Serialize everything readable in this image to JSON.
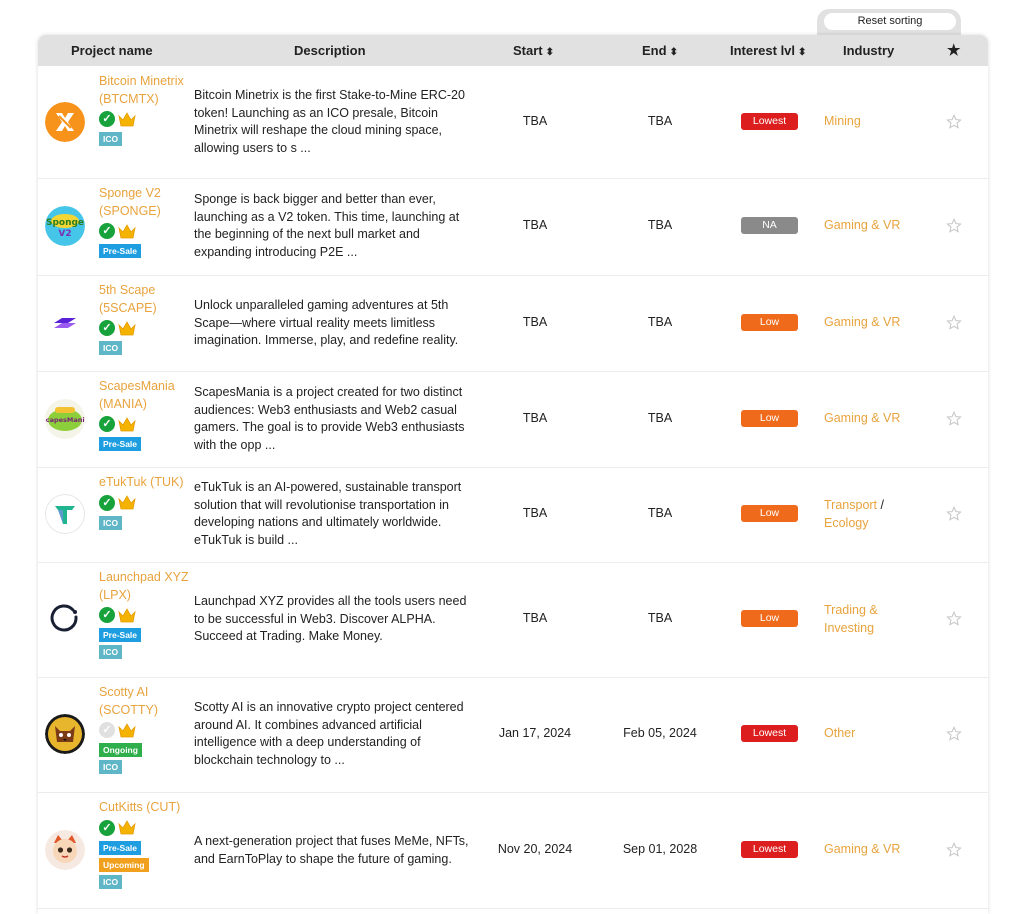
{
  "reset_label": "Reset sorting",
  "headers": {
    "project": "Project name",
    "description": "Description",
    "start": "Start",
    "end": "End",
    "interest": "Interest lvl",
    "industry": "Industry",
    "sort_glyph": "⬍",
    "fav_glyph": "★"
  },
  "colors": {
    "accent": "#e8a33d",
    "lowest": "#dc1e1e",
    "low": "#f06a1c",
    "na": "#8a8a8a",
    "check": "#18a23c",
    "ico_tag": "#5fb6c6",
    "presale_tag": "#1e9ee0",
    "ongoing_tag": "#2fae4c",
    "upcoming_tag": "#f0a01c"
  },
  "rows": [
    {
      "name": "Bitcoin Minetrix (BTCMTX)",
      "logo_icon": "btcmtx-x-logo-icon",
      "verified": true,
      "tags": [
        "ICO"
      ],
      "description": "Bitcoin Minetrix is the first Stake-to-Mine ERC-20 token! Launching as an ICO presale, Bitcoin Minetrix will reshape the cloud mining space, allowing users to s ...",
      "start": "TBA",
      "end": "TBA",
      "interest": "Lowest",
      "industry": [
        "Mining"
      ]
    },
    {
      "name": "Sponge V2 (SPONGE)",
      "logo_icon": "sponge-v2-logo-icon",
      "verified": true,
      "tags": [
        "Pre-Sale"
      ],
      "description": "Sponge is back bigger and better than ever, launching as a V2 token. This time, launching at the beginning of the next bull market and expanding introducing P2E ...",
      "start": "TBA",
      "end": "TBA",
      "interest": "NA",
      "industry": [
        "Gaming & VR"
      ]
    },
    {
      "name": "5th Scape (5SCAPE)",
      "logo_icon": "5thscape-s-logo-icon",
      "verified": true,
      "tags": [
        "ICO"
      ],
      "description": "Unlock unparalleled gaming adventures at 5th Scape—where virtual reality meets limitless imagination. Immerse, play, and redefine reality.",
      "start": "TBA",
      "end": "TBA",
      "interest": "Low",
      "industry": [
        "Gaming & VR"
      ]
    },
    {
      "name": "ScapesMania (MANIA)",
      "logo_icon": "scapesmania-logo-icon",
      "logo_text": "ScapesMania",
      "verified": true,
      "tags": [
        "Pre-Sale"
      ],
      "description": "ScapesMania is a project created for two distinct audiences: Web3 enthusiasts and Web2 casual gamers. The goal is to provide Web3 enthusiasts with the opp ...",
      "start": "TBA",
      "end": "TBA",
      "interest": "Low",
      "industry": [
        "Gaming & VR"
      ]
    },
    {
      "name": "eTukTuk (TUK)",
      "logo_icon": "etuktuk-t-logo-icon",
      "verified": true,
      "tags": [
        "ICO"
      ],
      "description": "eTukTuk is an AI-powered, sustainable transport solution that will revolutionise transportation in developing nations and ultimately worldwide. eTukTuk is build ...",
      "start": "TBA",
      "end": "TBA",
      "interest": "Low",
      "industry": [
        "Transport",
        "Ecology"
      ]
    },
    {
      "name": "Launchpad XYZ (LPX)",
      "logo_icon": "launchpad-ring-logo-icon",
      "verified": true,
      "tags": [
        "Pre-Sale",
        "ICO"
      ],
      "description": "Launchpad XYZ provides all the tools users need to be successful in Web3. Discover ALPHA. Succeed at Trading. Make Money.",
      "start": "TBA",
      "end": "TBA",
      "interest": "Low",
      "industry": [
        "Trading & Investing"
      ]
    },
    {
      "name": "Scotty AI (SCOTTY)",
      "logo_icon": "scotty-dog-logo-icon",
      "verified": false,
      "tags": [
        "Ongoing",
        "ICO"
      ],
      "description": "Scotty AI is an innovative crypto project centered around AI. It combines advanced artificial intelligence with a deep understanding of blockchain technology to ...",
      "start": "Jan 17, 2024",
      "end": "Feb 05, 2024",
      "interest": "Lowest",
      "industry": [
        "Other"
      ]
    },
    {
      "name": "CutKitts (CUT)",
      "logo_icon": "cutkitts-cat-logo-icon",
      "verified": true,
      "tags": [
        "Pre-Sale",
        "Upcoming",
        "ICO"
      ],
      "description": "A next-generation project that fuses MeMe, NFTs, and EarnToPlay to shape the future of gaming.",
      "start": "Nov 20, 2024",
      "end": "Sep 01, 2028",
      "interest": "Lowest",
      "industry": [
        "Gaming & VR"
      ]
    }
  ]
}
